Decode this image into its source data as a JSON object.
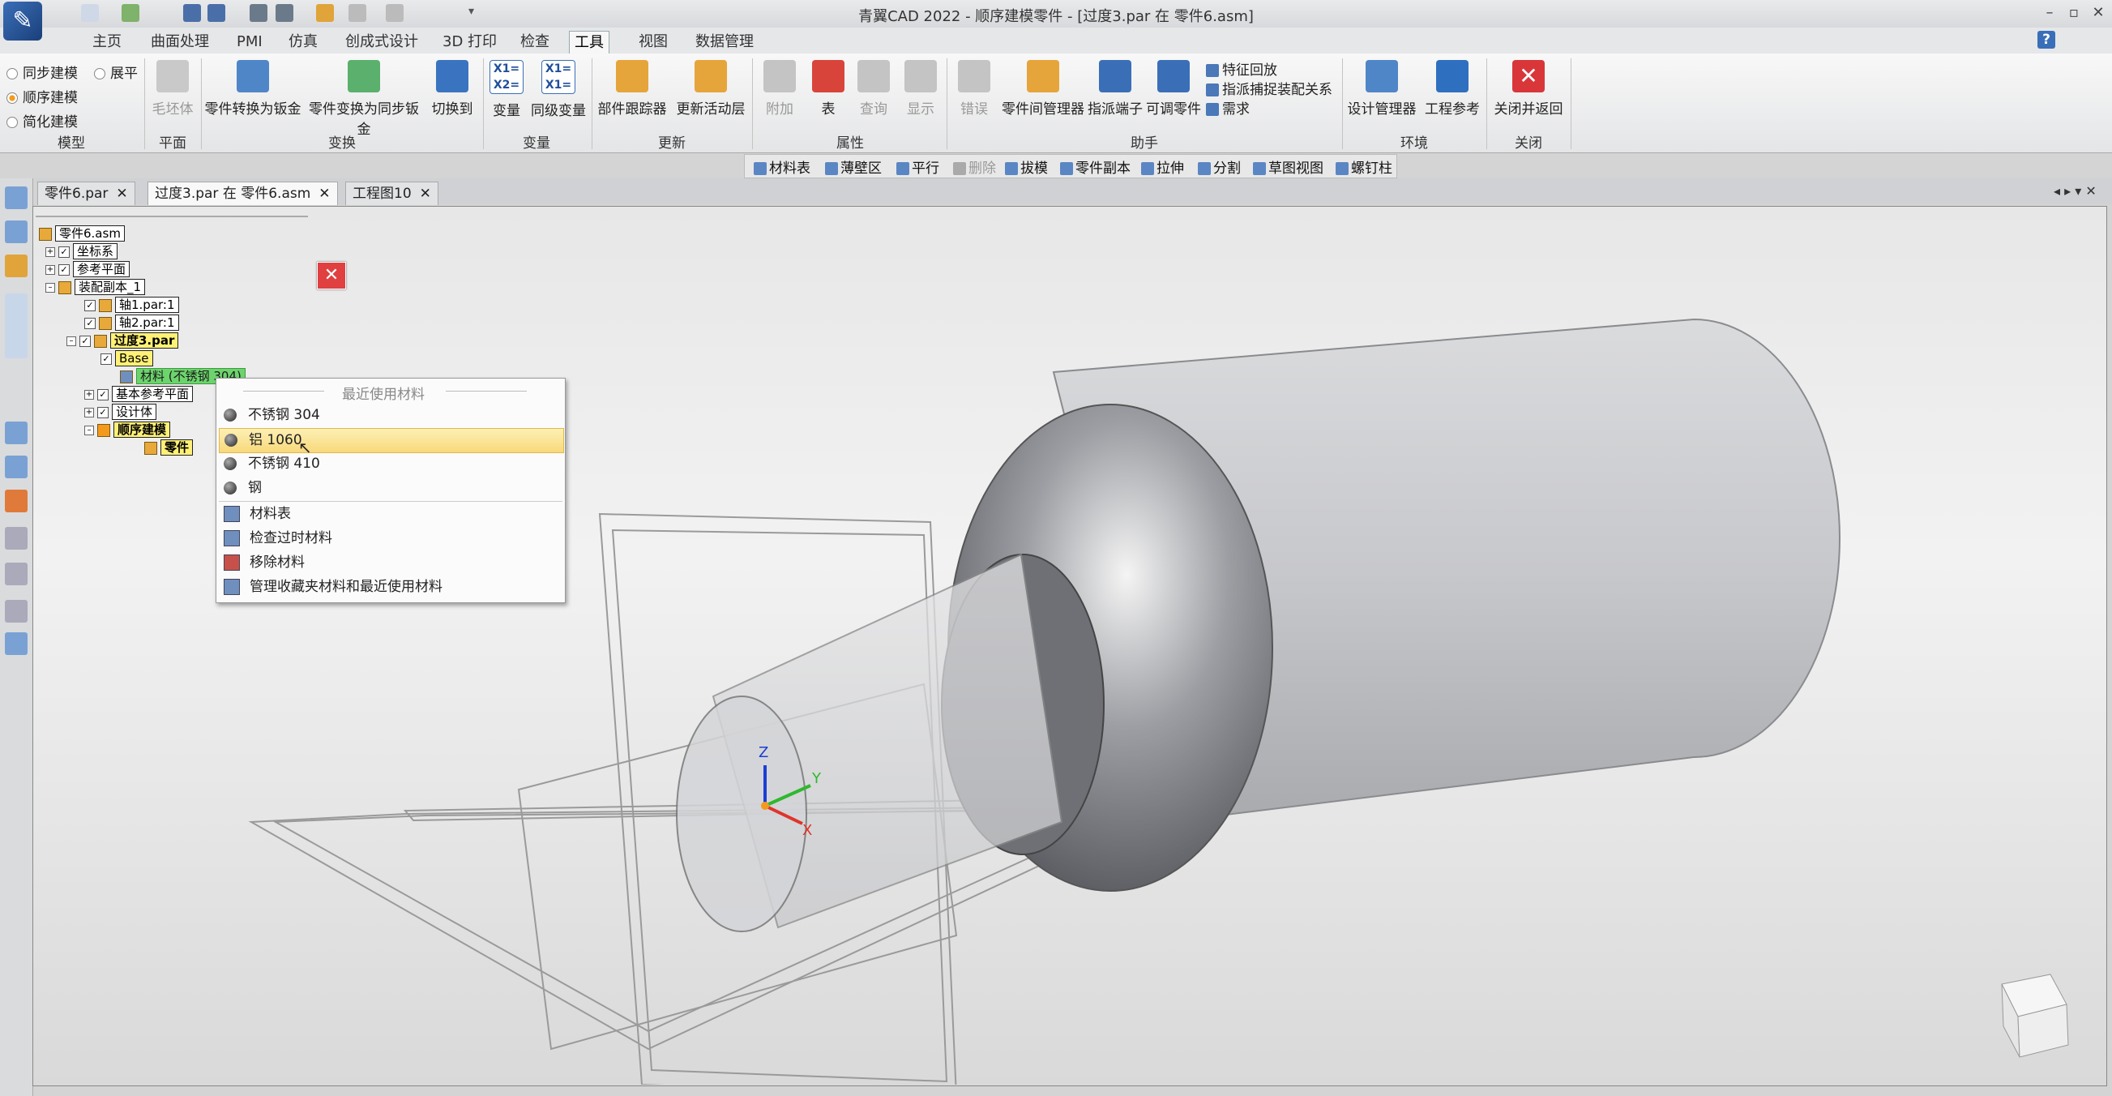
{
  "window": {
    "title": "青翼CAD 2022 - 顺序建模零件 - [过度3.par 在 零件6.asm]"
  },
  "menu": {
    "tabs": [
      "主页",
      "曲面处理",
      "PMI",
      "仿真",
      "创成式设计",
      "3D 打印",
      "检查",
      "工具",
      "视图",
      "数据管理"
    ],
    "active": "工具"
  },
  "ribbon": {
    "model_group": {
      "label": "模型",
      "options": [
        "同步建模",
        "顺序建模",
        "简化建模"
      ],
      "extra": "展平"
    },
    "plane_group": {
      "label": "平面",
      "buttons": [
        "毛坯体"
      ]
    },
    "transform_group": {
      "label": "变换",
      "buttons": [
        "零件转换为钣金",
        "零件变换为同步钣金",
        "切换到"
      ]
    },
    "variable_group": {
      "label": "变量",
      "buttons": [
        "变量",
        "同级变量"
      ]
    },
    "update_group": {
      "label": "更新",
      "buttons": [
        "部件跟踪器",
        "更新活动层"
      ]
    },
    "property_group": {
      "label": "属性",
      "buttons": [
        "附加",
        "表",
        "查询",
        "显示"
      ]
    },
    "helper_group": {
      "label": "助手",
      "buttons": [
        "错误",
        "零件间管理器",
        "指派端子",
        "可调零件"
      ],
      "small": [
        "特征回放",
        "指派捕捉装配关系",
        "需求"
      ]
    },
    "env_group": {
      "label": "环境",
      "buttons": [
        "设计管理器",
        "工程参考"
      ]
    },
    "close_group": {
      "label": "关闭",
      "buttons": [
        "关闭并返回"
      ]
    }
  },
  "commandbar": [
    "材料表",
    "薄壁区",
    "平行",
    "删除",
    "拔模",
    "零件副本",
    "拉伸",
    "分割",
    "草图视图",
    "螺钉柱"
  ],
  "doctabs": [
    "零件6.par",
    "过度3.par 在 零件6.asm",
    "工程图10"
  ],
  "tree": {
    "root": "零件6.asm",
    "nodes": [
      "坐标系",
      "参考平面",
      "装配副本_1",
      "轴1.par:1",
      "轴2.par:1",
      "过度3.par",
      "Base",
      "材料 (不锈钢 304)",
      "基本参考平面",
      "设计体",
      "顺序建模",
      "零件"
    ]
  },
  "context_menu": {
    "header": "最近使用材料",
    "recent": [
      "不锈钢 304",
      "铝 1060",
      "不锈钢 410",
      "钢"
    ],
    "highlighted": "铝 1060",
    "actions": [
      "材料表",
      "检查过时材料",
      "移除材料",
      "管理收藏夹材料和最近使用材料"
    ]
  },
  "axes": {
    "x": "X",
    "y": "Y",
    "z": "Z"
  },
  "colors": {
    "accent": "#f39a1c",
    "highlight": "#fbe6a0",
    "part": "#8a8d93"
  }
}
